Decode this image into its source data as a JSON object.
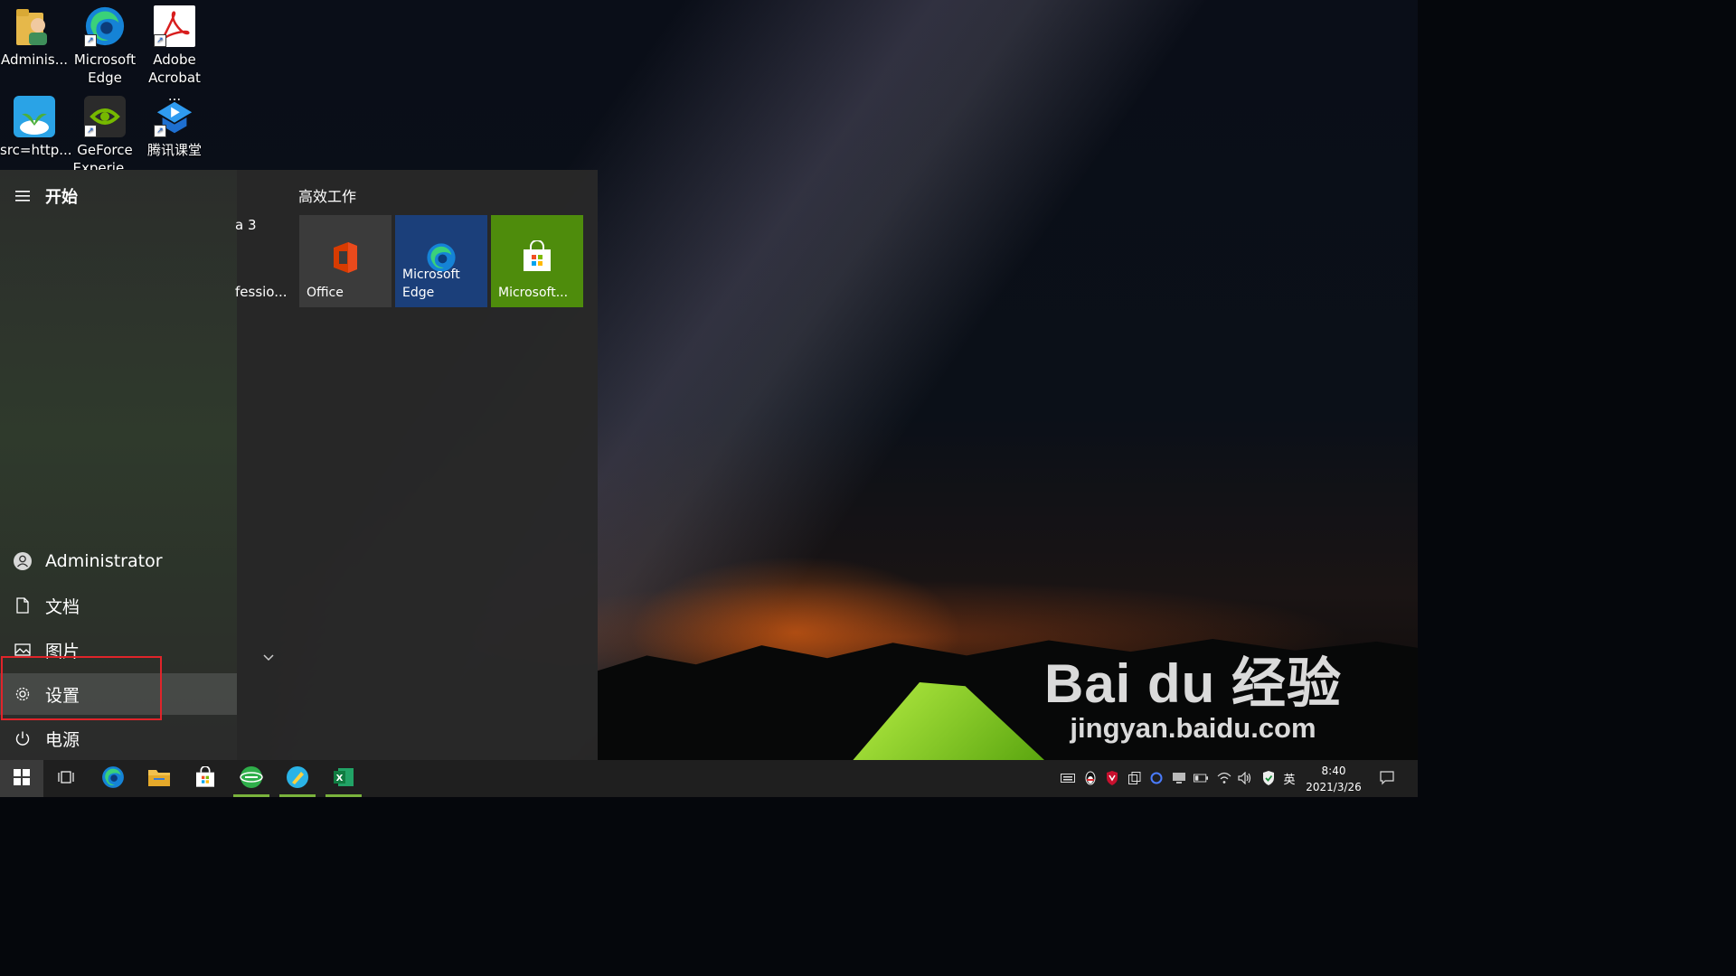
{
  "desktop": {
    "icons": [
      {
        "label": "Adminis..."
      },
      {
        "label": "Microsoft Edge"
      },
      {
        "label": "Adobe Acrobat ..."
      },
      {
        "label": "src=http..."
      },
      {
        "label": "GeForce Experie..."
      },
      {
        "label": "腾讯课堂"
      }
    ]
  },
  "start_menu": {
    "title": "开始",
    "nav": {
      "user": "Administrator",
      "documents": "文档",
      "pictures": "图片",
      "settings": "设置",
      "power": "电源"
    },
    "app_list_partial": [
      "a 3",
      "fessio..."
    ],
    "group_title": "高效工作",
    "tiles": [
      {
        "label": "Office",
        "color": "#3b3b3b"
      },
      {
        "label": "Microsoft Edge",
        "color": "#1b3f7a"
      },
      {
        "label": "Microsoft...",
        "color": "#4e8c0c"
      }
    ]
  },
  "taskbar": {
    "language": "英",
    "time": "8:40",
    "date": "2021/3/26"
  },
  "watermark": {
    "brand": "Bai du 经验",
    "url": "jingyan.baidu.com"
  },
  "colors": {
    "highlight_border": "#e0242a",
    "running_indicator": "#7ab33c"
  }
}
